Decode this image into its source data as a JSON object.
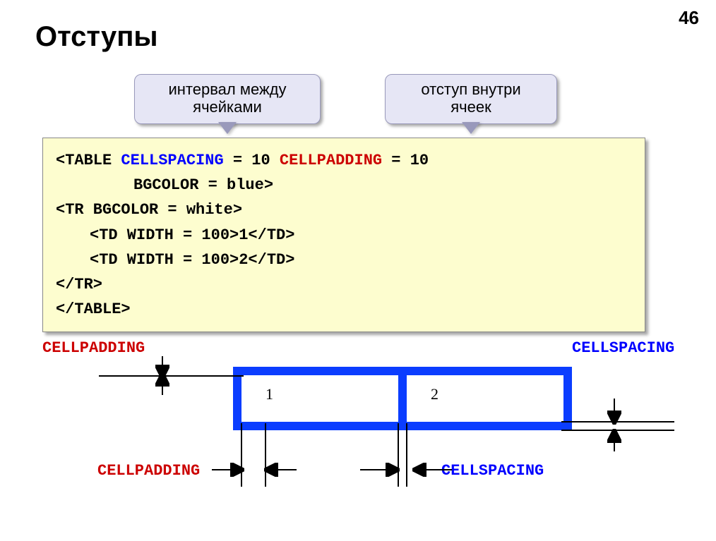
{
  "page_number": "46",
  "title": "Отступы",
  "callouts": {
    "spacing": {
      "line1": "интервал между",
      "line2": "ячейками"
    },
    "padding": {
      "line1": "отступ внутри",
      "line2": "ячеек"
    }
  },
  "code": {
    "line1_a": "<TABLE ",
    "line1_b": "CELLSPACING",
    "line1_c": " = 10 ",
    "line1_d": "CELLPADDING",
    "line1_e": " = 10",
    "line2": "BGCOLOR = blue>",
    "line3": "<TR BGCOLOR = white>",
    "line4": "<TD WIDTH = 100>1</TD>",
    "line5": "<TD WIDTH = 100>2</TD>",
    "line6": "</TR>",
    "line7": "</TABLE>"
  },
  "labels": {
    "cellpadding": "CELLPADDING",
    "cellspacing": "CELLSPACING"
  },
  "table_demo": {
    "cell1": "1",
    "cell2": "2"
  },
  "colors": {
    "blue": "#0000ff",
    "red": "#cc0000",
    "callout_bg": "#e6e6f5",
    "code_bg": "#fdfdcf",
    "diagram_blue": "#0b3dff"
  }
}
